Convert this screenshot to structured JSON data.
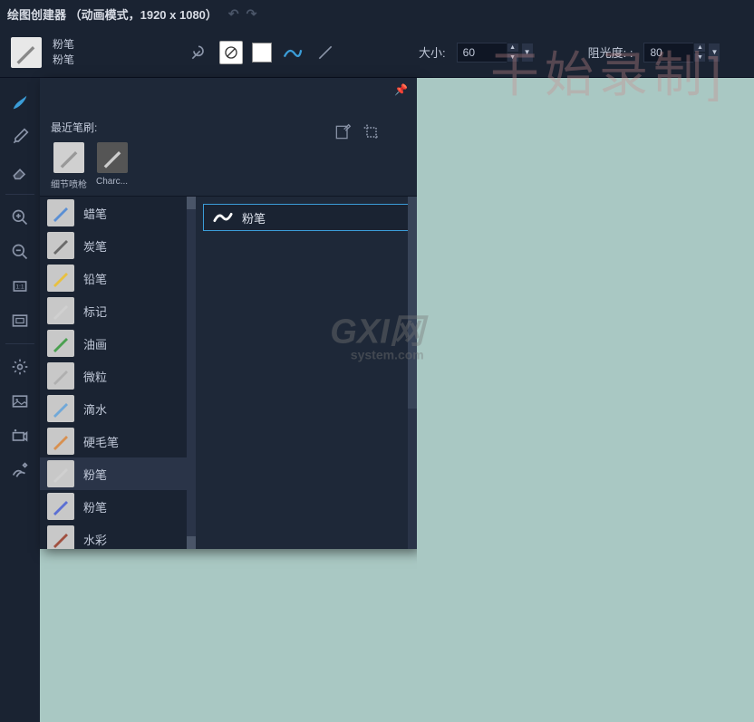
{
  "titlebar": {
    "title": "绘图创建器 （动画模式，1920 x 1080）"
  },
  "toolbar": {
    "brush_name_1": "粉笔",
    "brush_name_2": "粉笔",
    "size_label": "大小:",
    "size_value": "60",
    "opacity_label": "阻光度: :",
    "opacity_value": "80"
  },
  "sidebar": {
    "tools": [
      "brush",
      "eyedropper",
      "eraser"
    ],
    "view": [
      "zoom-in",
      "zoom-out",
      "actual-size",
      "fit-screen"
    ],
    "other": [
      "settings",
      "image",
      "camera",
      "effects"
    ]
  },
  "panel": {
    "recent_label": "最近笔刷:",
    "recent": [
      {
        "caption": "细节喷枪"
      },
      {
        "caption": "Charc..."
      }
    ],
    "categories": [
      {
        "label": "蜡笔",
        "color": "#5b8fd4"
      },
      {
        "label": "炭笔",
        "color": "#6a6a6a"
      },
      {
        "label": "铅笔",
        "color": "#e8c040"
      },
      {
        "label": "标记",
        "color": "#d0d0d0"
      },
      {
        "label": "油画",
        "color": "#4aa050"
      },
      {
        "label": "微粒",
        "color": "#b0b0b0"
      },
      {
        "label": "滴水",
        "color": "#70a8d8"
      },
      {
        "label": "硬毛笔",
        "color": "#d89050"
      },
      {
        "label": "粉笔",
        "color": "#d0d0d0",
        "selected": true
      },
      {
        "label": "粉笔",
        "color": "#5b6fd4"
      },
      {
        "label": "水彩",
        "color": "#a05040"
      }
    ],
    "variant": {
      "label": "粉笔"
    }
  },
  "watermark": {
    "text1": "干始录制]",
    "text2_main": "GXI网",
    "text2_sub": "system.com"
  }
}
